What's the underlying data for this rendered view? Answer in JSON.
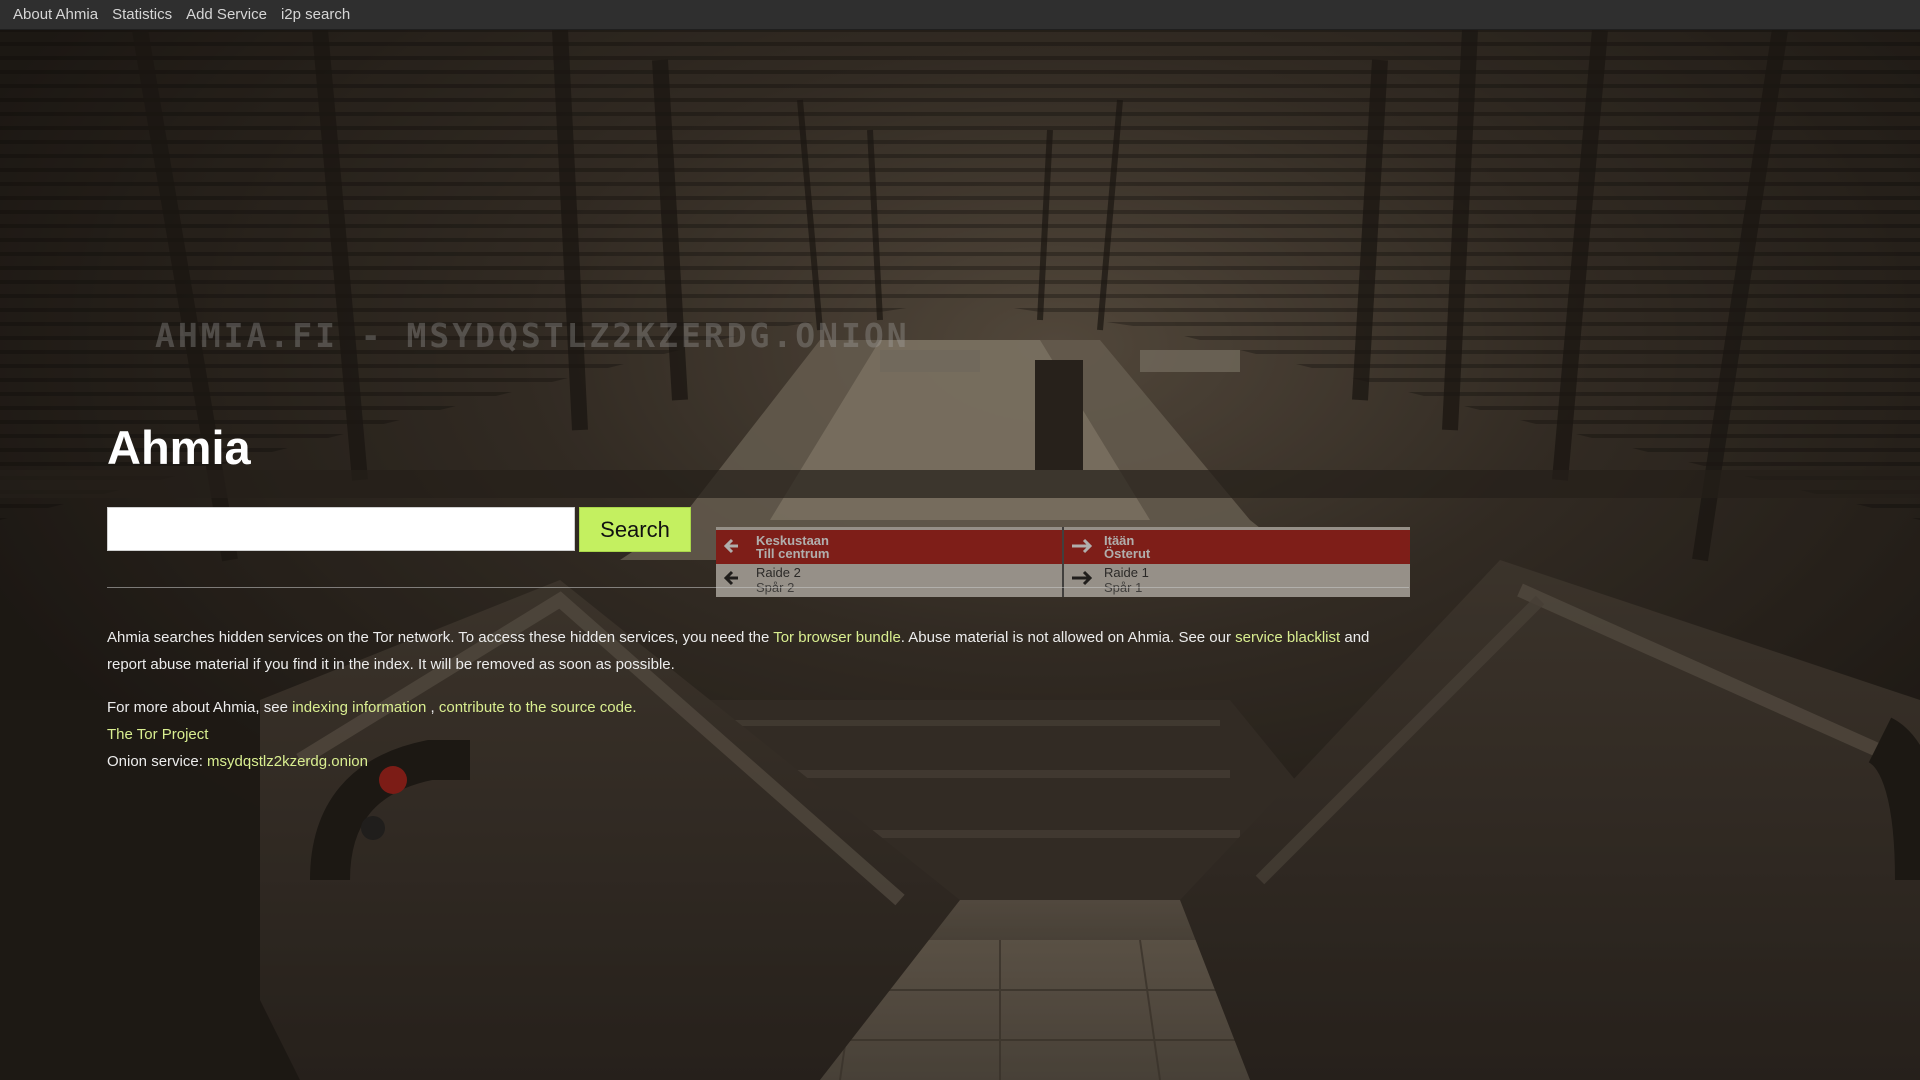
{
  "nav": {
    "items": [
      "About Ahmia",
      "Statistics",
      "Add Service",
      "i2p search"
    ]
  },
  "watermark": "AHMIA.FI - MSYDQSTLZ2KZERDG.ONION",
  "title": "Ahmia",
  "search": {
    "value": "",
    "placeholder": "",
    "button_label": "Search"
  },
  "info": {
    "p1": {
      "t1": "Ahmia searches hidden services on the Tor network. To access these hidden services, you need the ",
      "link1": "Tor browser bundle",
      "t2": ". Abuse material is not allowed on Ahmia. See our ",
      "link2": "service blacklist",
      "t3": " and report abuse material if you find it in the index. It will be removed as soon as possible."
    },
    "p2": {
      "t1": "For more about Ahmia, see ",
      "link1": "indexing information",
      "t2": " , ",
      "link2": "contribute to the source code.",
      "tor_link": "The Tor Project",
      "onion_label": "Onion service: ",
      "onion_link": "msydqstlz2kzerdg.onion"
    }
  },
  "sign": {
    "left_top": "Keskustaan",
    "left_top2": "Till centrum",
    "left_bottom": "Raide 2",
    "left_bottom2": "Spår 2",
    "right_top": "Itään",
    "right_top2": "Österut",
    "right_bottom": "Raide 1",
    "right_bottom2": "Spår 1"
  },
  "colors": {
    "accent": "#c4f060",
    "link": "#d9ee90",
    "nav_bg": "#2f2f2f"
  }
}
